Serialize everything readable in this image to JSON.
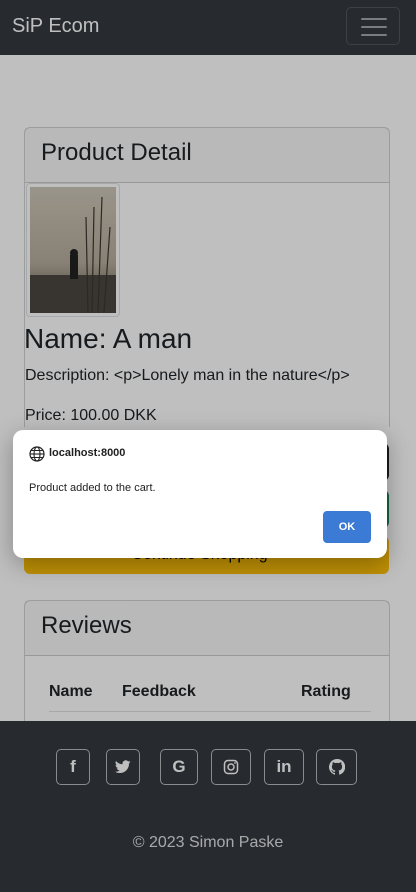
{
  "navbar": {
    "brand": "SiP Ecom"
  },
  "product": {
    "header": "Product Detail",
    "name": "Name: A man",
    "description": "Description: <p>Lonely man in the nature</p>",
    "price": "Price: 100.00 DKK",
    "continue_button": "Continue Shopping >"
  },
  "reviews": {
    "header": "Reviews",
    "columns": [
      "Name",
      "Feedback",
      "Rating"
    ]
  },
  "footer": {
    "social_icons": [
      "facebook-icon",
      "twitter-icon",
      "google-icon",
      "instagram-icon",
      "linkedin-icon",
      "github-icon"
    ],
    "copyright": "© 2023 Simon Paske"
  },
  "dialog": {
    "host": "localhost:8000",
    "message": "Product added to the cart.",
    "ok_label": "OK"
  },
  "colors": {
    "navbar": "#343a40",
    "warning": "#ffc107",
    "dialog_button": "#3b7bd6"
  }
}
